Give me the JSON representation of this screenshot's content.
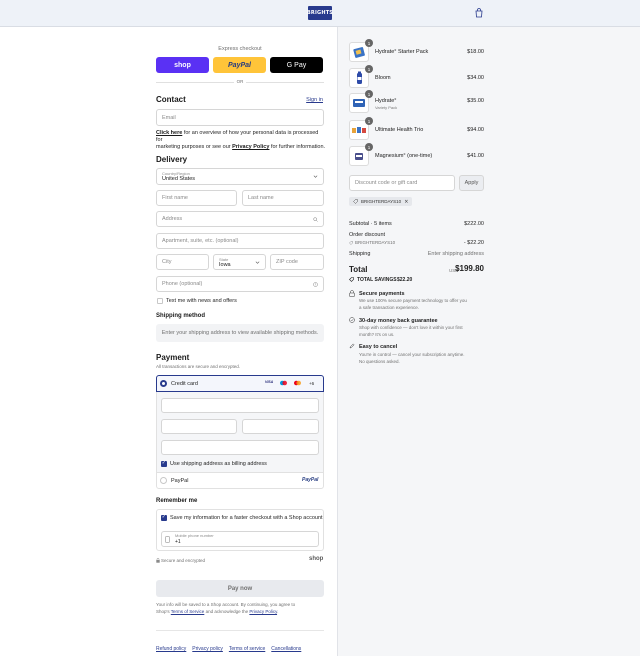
{
  "header": {
    "logo_text": "BRIGHTS",
    "cart_icon": "shopping-bag-icon"
  },
  "express": {
    "title": "Express checkout",
    "shop_label": "shop",
    "paypal_label": "PayPal",
    "gpay_label": "G Pay",
    "or_label": "OR"
  },
  "contact": {
    "title": "Contact",
    "sign_in": "Sign in",
    "email_placeholder": "Email",
    "privacy_click": "Click here",
    "privacy_text_1": " for an overview of how your personal data is processed for",
    "privacy_text_2": "marketing purposes or see our ",
    "privacy_policy": "Privacy Policy",
    "privacy_text_3": " for further information."
  },
  "delivery": {
    "title": "Delivery",
    "country_label": "Country/Region",
    "country_value": "United States",
    "first_name": "First name",
    "last_name": "Last name",
    "address": "Address",
    "apartment": "Apartment, suite, etc. (optional)",
    "city": "City",
    "state_label": "State",
    "state_value": "Iowa",
    "zip": "ZIP code",
    "phone": "Phone (optional)",
    "news_label": "Text me with news and offers"
  },
  "shipping": {
    "title": "Shipping method",
    "placeholder": "Enter your shipping address to view available shipping methods."
  },
  "payment": {
    "title": "Payment",
    "subtitle": "All transactions are secure and encrypted.",
    "credit_card": "Credit card",
    "more_cards": "+6",
    "billing_label": "Use shipping address as billing address",
    "paypal": "PayPal",
    "paypal_logo": "PayPal"
  },
  "remember": {
    "title": "Remember me",
    "save_label": "Save my information for a faster checkout with a Shop account",
    "phone_label": "Mobile phone number",
    "phone_value": "+1",
    "secure": "Secure and encrypted",
    "shop": "shop"
  },
  "pay_now": "Pay now",
  "shop_note_1": "Your info will be saved to a Shop account. By continuing, you agree to",
  "shop_note_2": "Shop's ",
  "terms": "Terms of Service",
  "shop_note_3": " and acknowledge the ",
  "privacy": "Privacy Policy",
  "shop_note_4": ".",
  "footer": {
    "links": [
      "Refund policy",
      "Privacy policy",
      "Terms of service",
      "Cancellations"
    ]
  },
  "cart": {
    "items": [
      {
        "name": "Hydrate° Starter Pack",
        "sub": "",
        "qty": "1",
        "price": "$18.00"
      },
      {
        "name": "Bloom",
        "sub": "",
        "qty": "1",
        "price": "$34.00"
      },
      {
        "name": "Hydrate°",
        "sub": "Variety Pack",
        "qty": "1",
        "price": "$35.00"
      },
      {
        "name": "Ultimate Health Trio",
        "sub": "",
        "qty": "1",
        "price": "$94.00"
      },
      {
        "name": "Magnesium° (one-time)",
        "sub": "",
        "qty": "1",
        "price": "$41.00"
      }
    ],
    "discount_placeholder": "Discount code or gift card",
    "apply": "Apply",
    "code_chip": "BRIGHTERDAYS10",
    "subtotal_label": "Subtotal · 5 items",
    "subtotal_value": "$222.00",
    "order_discount_label": "Order discount",
    "order_discount_code": "BRIGHTERDAYS10",
    "order_discount_value": "- $22.20",
    "shipping_label": "Shipping",
    "shipping_value": "Enter shipping address",
    "total_label": "Total",
    "currency": "USD",
    "total_value": "$199.80",
    "savings_label": "TOTAL SAVINGS",
    "savings_value": "$22.20"
  },
  "perks": [
    {
      "title": "Secure payments",
      "text_1": "We use 100% secure payment technology to offer you",
      "text_2": "a safe transaction experience."
    },
    {
      "title": "30-day money back guarantee",
      "text_1": "Shop with confidence — don't love it within your first",
      "text_2": "month? It's on us."
    },
    {
      "title": "Easy to cancel",
      "text_1": "You're in control — cancel your subscription anytime.",
      "text_2": "No questions asked."
    }
  ],
  "colors": {
    "accent": "#283a8d",
    "shop": "#5a31f4",
    "paypal": "#ffc439",
    "gpay": "#000000"
  }
}
